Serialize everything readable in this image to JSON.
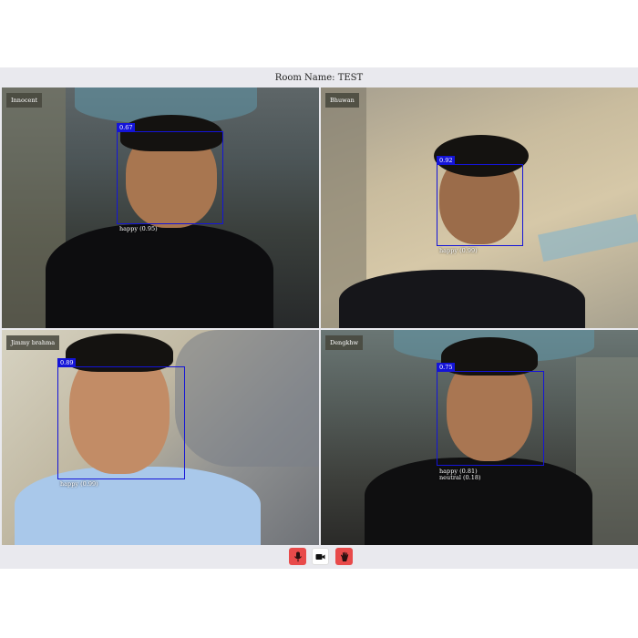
{
  "room": {
    "label": "Room Name: TEST"
  },
  "participants": [
    {
      "name": "Innocent",
      "score": "0.67",
      "emotions": [
        "happy (0.95)"
      ]
    },
    {
      "name": "Bhuwan",
      "score": "0.92",
      "emotions": [
        "happy (0.99)"
      ]
    },
    {
      "name": "Jimmy brahma",
      "score": "0.89",
      "emotions": [
        "happy (0.99)"
      ]
    },
    {
      "name": "Dengkhw",
      "score": "0.75",
      "emotions": [
        "happy (0.81)",
        "neutral (0.18)"
      ]
    }
  ],
  "controls": {
    "mic_icon": "microphone-icon",
    "camera_icon": "video-camera-icon",
    "hand_icon": "raise-hand-icon"
  },
  "colors": {
    "detection_box": "#1414d8",
    "control_active": "#e84a4a",
    "background": "#e9e9ee"
  }
}
